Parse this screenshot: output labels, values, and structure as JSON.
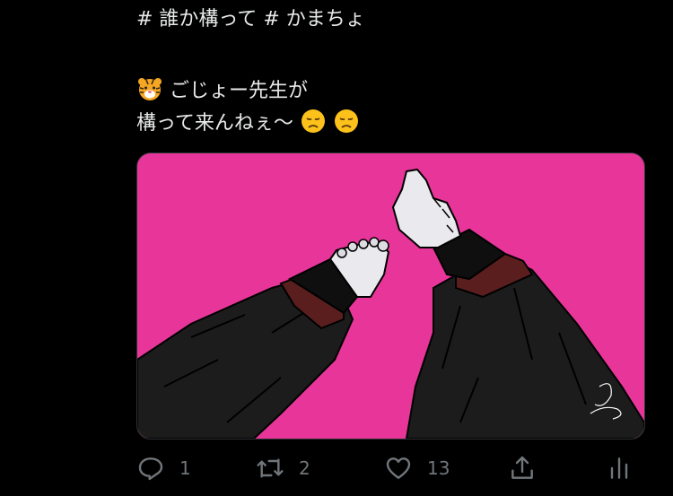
{
  "tweet": {
    "hashtag_line": "# 誰か構って  # かまちょ",
    "line2_text": "ごじょー先生が",
    "line3_text": "構って来んねぇ〜"
  },
  "emojis": [
    "tiger-face",
    "disappointed-face",
    "disappointed-face"
  ],
  "actions": {
    "reply_count": "1",
    "retweet_count": "2",
    "like_count": "13"
  },
  "media": {
    "background_color": "#e8359a"
  }
}
